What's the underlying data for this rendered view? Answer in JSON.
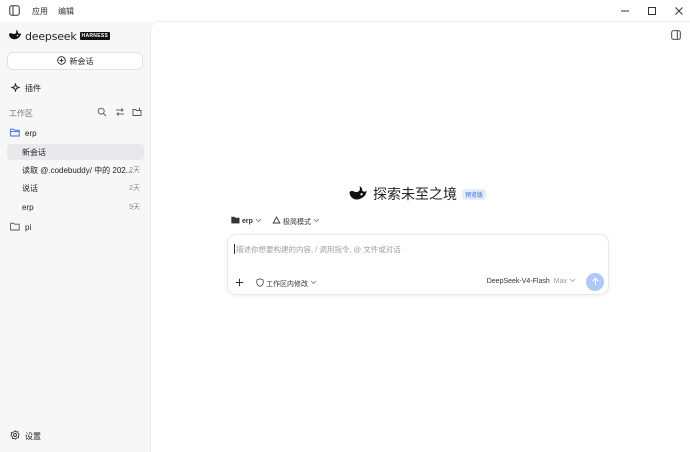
{
  "menu": {
    "app": "应用",
    "edit": "编辑"
  },
  "brand": {
    "name": "deepseek",
    "tag": "HARNESS",
    "color": "#4d6bfe"
  },
  "sidebar": {
    "new_chat": "新会话",
    "plugins": "插件",
    "workspace_label": "工作区",
    "projects": [
      {
        "name": "erp",
        "icon": "folder-open-icon",
        "chats": [
          {
            "title": "新会话",
            "age": "",
            "active": true
          },
          {
            "title": "读取 @.codebuddy/ 中的 202...",
            "age": "2天"
          },
          {
            "title": "说话",
            "age": "2天"
          },
          {
            "title": "erp",
            "age": "9天"
          }
        ]
      },
      {
        "name": "pi",
        "icon": "folder-icon"
      }
    ],
    "settings": "设置"
  },
  "main": {
    "hero_title": "探索未至之境",
    "preview_badge": "预览版",
    "project_chip": "erp",
    "mode_chip": "极简模式",
    "composer_placeholder": "描述你想要构建的内容, / 调用指令, @ 文件或对话",
    "workspace_modify": "工作区内修改",
    "model": "DeepSeek-V4-Flash",
    "model_level": "Max",
    "send_color": "#aec8f7"
  }
}
